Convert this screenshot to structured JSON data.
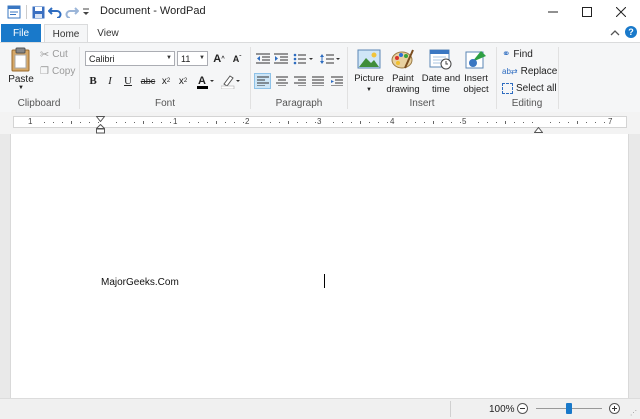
{
  "window": {
    "title": "Document - WordPad"
  },
  "tabs": [
    {
      "label": "File"
    },
    {
      "label": "Home"
    },
    {
      "label": "View"
    }
  ],
  "clipboard": {
    "group_label": "Clipboard",
    "paste": "Paste",
    "cut": "Cut",
    "copy": "Copy"
  },
  "font": {
    "group_label": "Font",
    "family": "Calibri",
    "size": "11"
  },
  "paragraph": {
    "group_label": "Paragraph"
  },
  "insert": {
    "group_label": "Insert",
    "picture": "Picture",
    "paint_l1": "Paint",
    "paint_l2": "drawing",
    "datetime_l1": "Date and",
    "datetime_l2": "time",
    "object_l1": "Insert",
    "object_l2": "object"
  },
  "editing": {
    "group_label": "Editing",
    "find": "Find",
    "replace": "Replace",
    "select_all": "Select all"
  },
  "ruler": {
    "numbers": [
      "1",
      "1",
      "2",
      "3",
      "4",
      "5",
      "7"
    ]
  },
  "document": {
    "text": "MajorGeeks.Com"
  },
  "status": {
    "zoom": "100%"
  },
  "colors": {
    "accent": "#1979ca",
    "ribbon_bg": "#f5f6f7"
  }
}
